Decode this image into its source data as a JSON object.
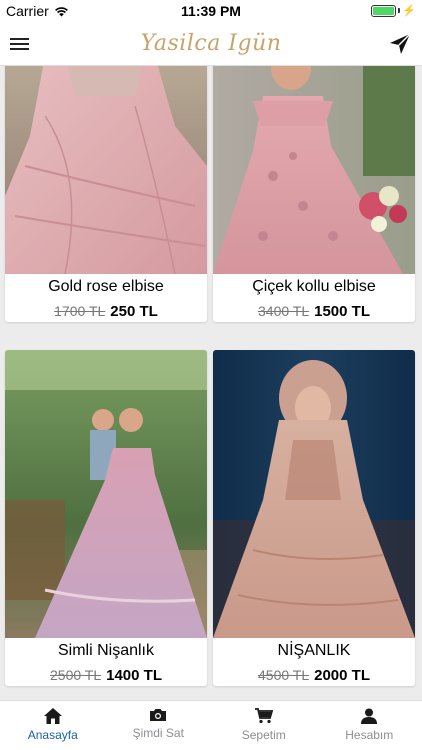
{
  "status": {
    "carrier": "Carrier",
    "time": "11:39 PM",
    "battery_level": 1.0
  },
  "header": {
    "logo_text": "Yasilca Igün",
    "menu_icon": "hamburger-menu-icon",
    "send_icon": "paper-plane-icon"
  },
  "products": [
    {
      "title": "Gold rose elbise",
      "old_price": "1700 TL",
      "price": "250 TL"
    },
    {
      "title": "Çiçek kollu elbise",
      "old_price": "3400 TL",
      "price": "1500 TL"
    },
    {
      "title": "Simli Nişanlık",
      "old_price": "2500 TL",
      "price": "1400 TL"
    },
    {
      "title": "NİŞANLIK",
      "old_price": "4500 TL",
      "price": "2000 TL"
    }
  ],
  "tabs": [
    {
      "label": "Anasayfa",
      "icon": "home-icon",
      "active": true
    },
    {
      "label": "Şimdi Sat",
      "icon": "camera-icon",
      "active": false
    },
    {
      "label": "Sepetim",
      "icon": "cart-icon",
      "active": false
    },
    {
      "label": "Hesabım",
      "icon": "user-icon",
      "active": false
    }
  ],
  "colors": {
    "accent": "#1a62a8",
    "logo": "#c9a36a",
    "inactive_tab": "#8e8e93"
  }
}
